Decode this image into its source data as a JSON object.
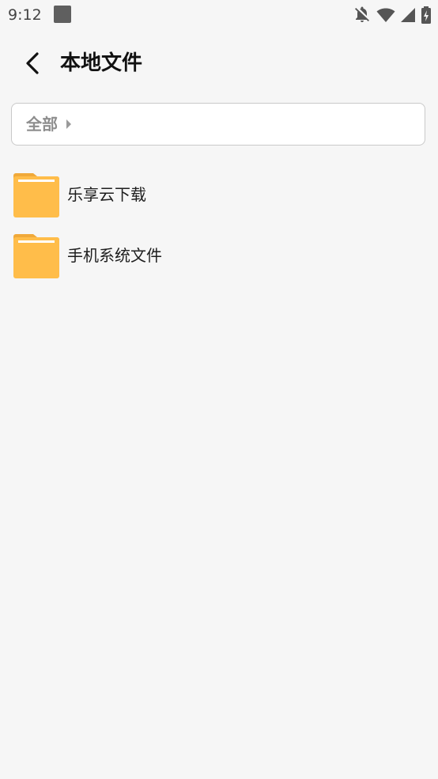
{
  "status_bar": {
    "time": "9:12",
    "icons": [
      "notifications-off-icon",
      "wifi-icon",
      "cellular-signal-icon",
      "battery-charging-icon"
    ]
  },
  "header": {
    "title": "本地文件",
    "back_icon": "chevron-left-icon"
  },
  "breadcrumb": {
    "items": [
      {
        "label": "全部"
      }
    ],
    "separator_icon": "caret-right-icon"
  },
  "file_list": {
    "items": [
      {
        "name": "乐享云下载",
        "icon": "folder-icon"
      },
      {
        "name": "手机系统文件",
        "icon": "folder-icon"
      }
    ]
  },
  "colors": {
    "background": "#f6f6f6",
    "folder_body": "#ffbd4a",
    "folder_tab": "#f0a93a",
    "breadcrumb_text": "#8e8e8e"
  }
}
